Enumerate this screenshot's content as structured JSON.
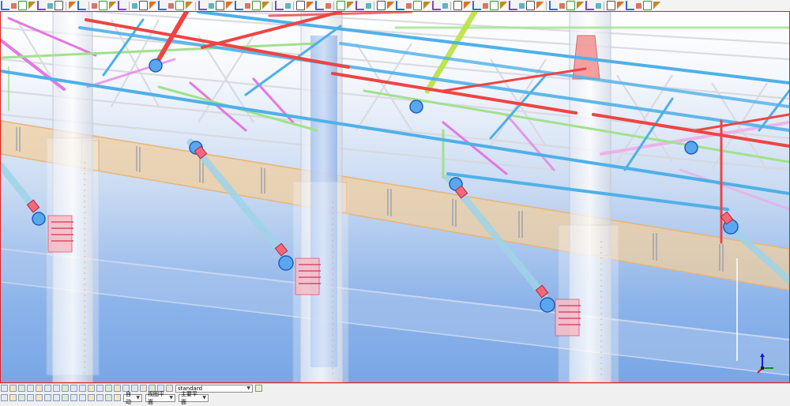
{
  "toolbar_top": {
    "groups": [
      {
        "icons": [
          "pointer-icon",
          "pipe-icon",
          "beam-icon",
          "curved-beam-icon",
          "polybeam-icon",
          "line-icon",
          "weld-icon"
        ]
      },
      {
        "icons": [
          "move-icon",
          "hand-icon"
        ]
      },
      {
        "icons": [
          "model-icon",
          "component-icon",
          "catalog-icon",
          "save-icon"
        ]
      },
      {
        "icons": [
          "bolt-icon",
          "cut-icon",
          "fitting-icon",
          "plate-icon",
          "connection-icon",
          "detail-icon",
          "close-icon"
        ]
      },
      {
        "icons": [
          "measure-icon",
          "measure-angle-icon",
          "snap-icon",
          "snap-end-icon",
          "snap-mid-icon",
          "snap-intersect-icon",
          "snap-perpendicular-icon",
          "snap-grid-icon"
        ]
      },
      {
        "icons": [
          "tag-icon",
          "target-icon"
        ]
      },
      {
        "icons": [
          "new-icon",
          "open-icon",
          "save-file-icon",
          "print-icon"
        ]
      },
      {
        "icons": [
          "undo-icon",
          "redo-icon",
          "copy-icon",
          "paste-icon"
        ]
      },
      {
        "icons": [
          "view-icon",
          "view-3d-icon",
          "clip-icon",
          "zoom-icon",
          "zoom-in-icon",
          "zoom-out-icon",
          "pan-icon",
          "rotate-icon"
        ]
      },
      {
        "icons": [
          "select-all-icon",
          "select-part-icon",
          "select-assembly-icon",
          "select-bolt-icon",
          "select-weld-icon",
          "select-cut-icon",
          "select-grid-icon",
          "select-point-icon",
          "select-plane-icon",
          "select-component-icon"
        ]
      },
      {
        "icons": [
          "filter-icon",
          "filter-part-icon",
          "filter-bolt-icon",
          "filter-weld-icon",
          "filter-component-icon",
          "filter-grid-icon"
        ]
      },
      {
        "icons": [
          "properties-icon",
          "inquire-icon",
          "report-icon",
          "drawing-icon",
          "list-icon",
          "help-icon"
        ]
      }
    ]
  },
  "statusbar": {
    "row1_icons": [
      "select-objects-icon",
      "select-parts-icon",
      "select-surfaces-icon",
      "select-grid-icon",
      "select-points-icon",
      "select-cuts-icon",
      "select-welds-icon",
      "select-assemblies-icon",
      "select-components-icon",
      "select-bolts-icon",
      "select-reference-icon",
      "select-views-icon",
      "select-planes-icon",
      "select-all-icon",
      "snap-points-icon",
      "snap-edges-icon",
      "snap-center-icon",
      "snap-mid-icon",
      "snap-intersection-icon",
      "snap-perpendicular-icon"
    ],
    "filter_value": "standard",
    "filter_button_icon": "filter-settings-icon",
    "row2_icons": [
      "snap-toggle-icon",
      "snap-override-icon",
      "lock-icon",
      "ortho-icon",
      "ruler-icon",
      "grid-toggle-icon",
      "macro-icon",
      "clash-icon",
      "work-area-icon",
      "camera-icon",
      "info-icon",
      "plane-icon",
      "layer-icon",
      "render-icon"
    ],
    "snap_mode_value": "自动",
    "view_plane_value": "视图平面",
    "work_plane_value": "主要平面"
  },
  "colors": {
    "viewport_border": "#e02020",
    "sky_top": "#ffffff",
    "sky_bottom": "#78a6e6"
  }
}
